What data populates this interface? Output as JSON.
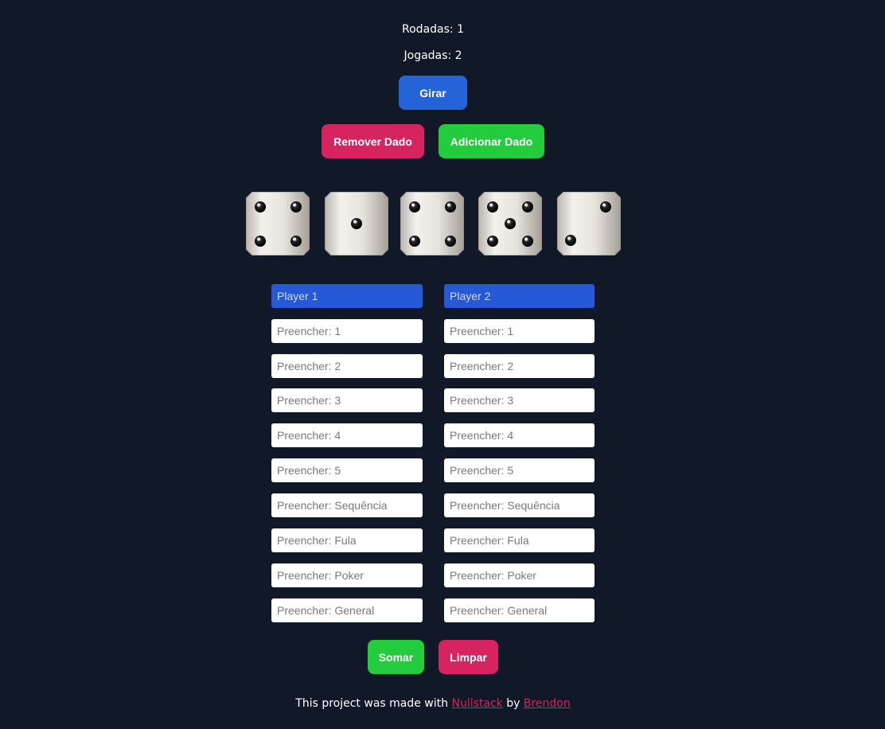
{
  "stats": {
    "rodadas": "Rodadas: 1",
    "jogadas": "Jogadas: 2"
  },
  "buttons": {
    "girar": "Girar",
    "remover": "Remover Dado",
    "adicionar": "Adicionar Dado",
    "somar": "Somar",
    "limpar": "Limpar"
  },
  "dice": [
    4,
    1,
    4,
    5,
    2
  ],
  "players": [
    {
      "name": "Player 1",
      "fields": [
        "Preencher: 1",
        "Preencher: 2",
        "Preencher: 3",
        "Preencher: 4",
        "Preencher: 5",
        "Preencher: Sequência",
        "Preencher: Fula",
        "Preencher: Poker",
        "Preencher: General"
      ]
    },
    {
      "name": "Player 2",
      "fields": [
        "Preencher: 1",
        "Preencher: 2",
        "Preencher: 3",
        "Preencher: 4",
        "Preencher: 5",
        "Preencher: Sequência",
        "Preencher: Fula",
        "Preencher: Poker",
        "Preencher: General"
      ]
    }
  ],
  "footer": {
    "prefix": "This project was made with ",
    "link1": "Nullstack",
    "middle": " by ",
    "link2": "Brendon"
  },
  "colors": {
    "background": "#111827",
    "blue": "#2563d9",
    "red": "#d5245f",
    "green": "#22cc3d"
  }
}
